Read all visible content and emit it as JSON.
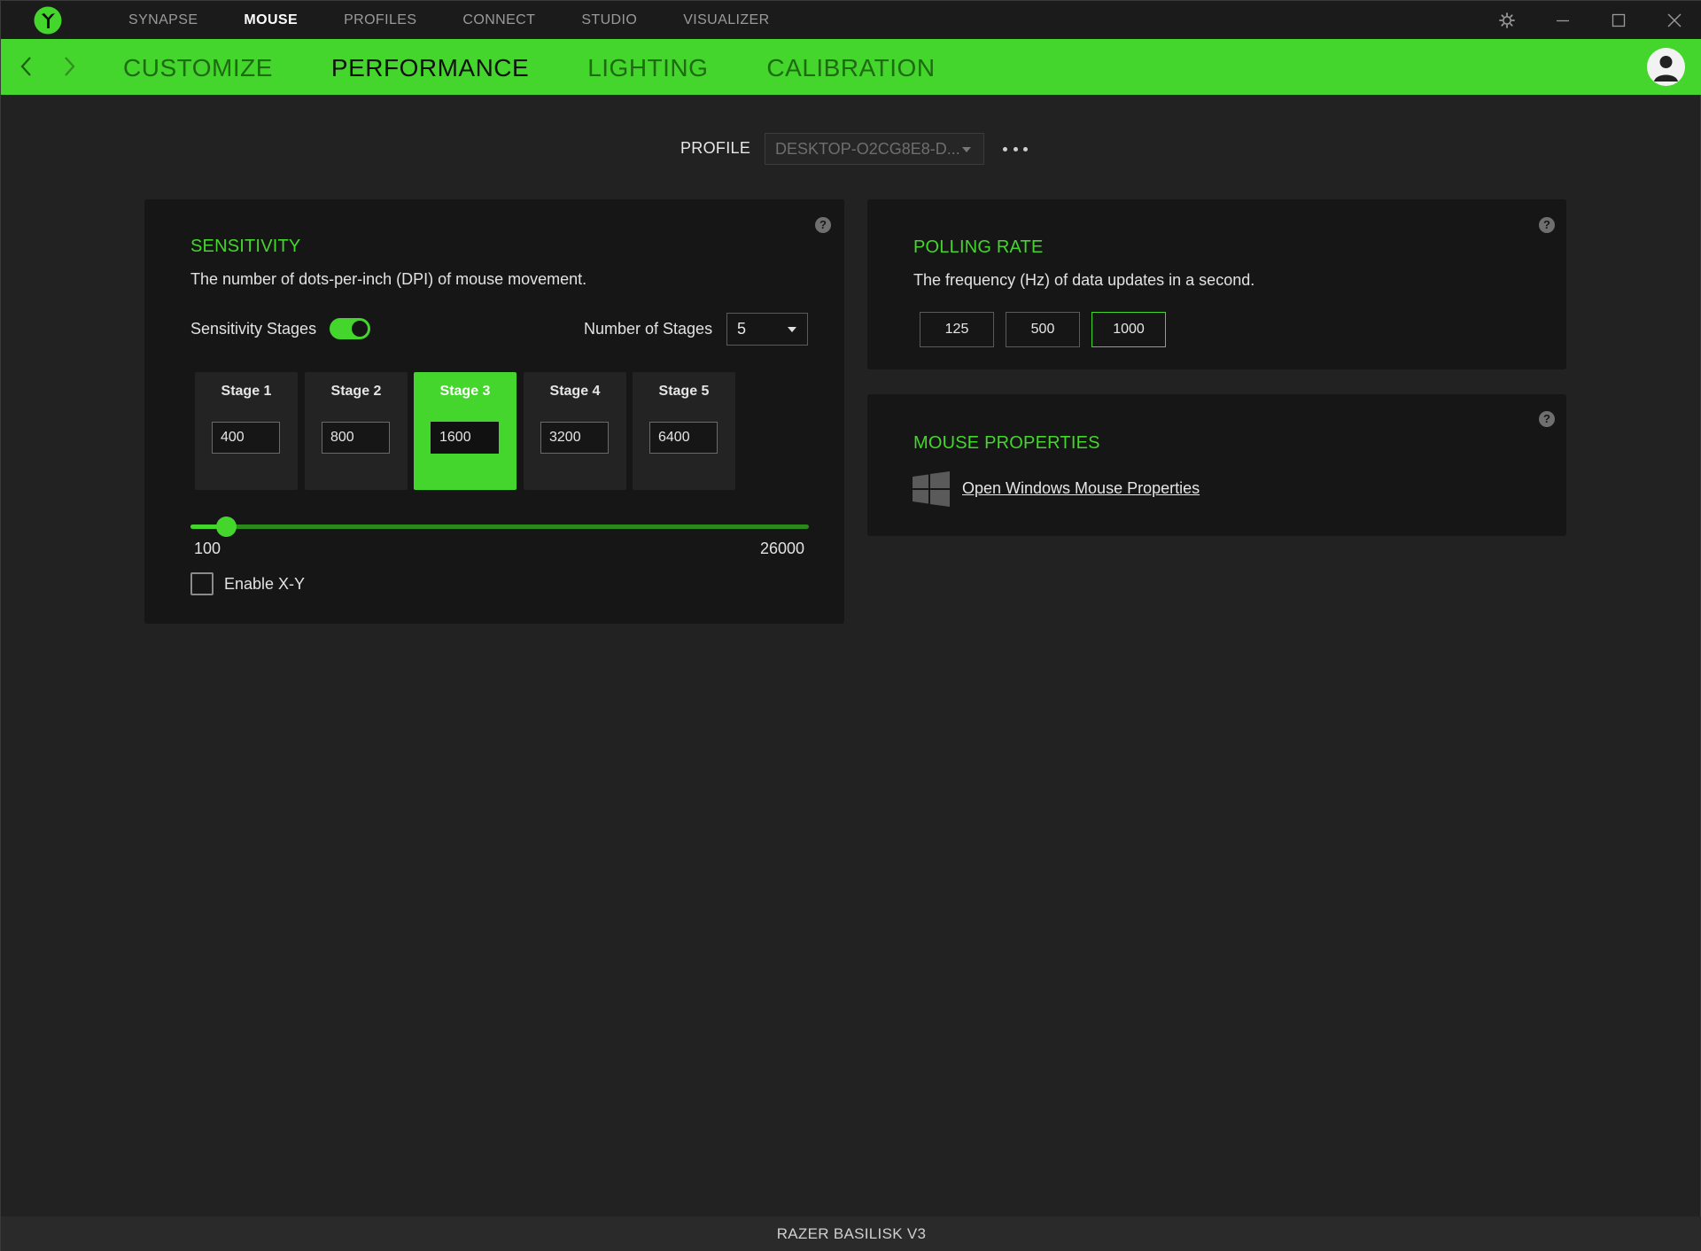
{
  "app": {
    "brand_color": "#44d62c",
    "logo_icon": "razer-snake-logo"
  },
  "top_nav": {
    "items": [
      {
        "label": "SYNAPSE"
      },
      {
        "label": "MOUSE"
      },
      {
        "label": "PROFILES"
      },
      {
        "label": "CONNECT"
      },
      {
        "label": "STUDIO"
      },
      {
        "label": "VISUALIZER"
      }
    ],
    "active": "MOUSE"
  },
  "window_controls": [
    "gear-icon",
    "minimize-icon",
    "maximize-icon",
    "close-icon"
  ],
  "sub_nav": {
    "items": [
      {
        "label": "CUSTOMIZE"
      },
      {
        "label": "PERFORMANCE"
      },
      {
        "label": "LIGHTING"
      },
      {
        "label": "CALIBRATION"
      }
    ],
    "active": "PERFORMANCE"
  },
  "profile": {
    "label": "PROFILE",
    "selected": "DESKTOP-O2CG8E8-D..."
  },
  "sensitivity": {
    "title": "SENSITIVITY",
    "description": "The number of dots-per-inch (DPI) of mouse movement.",
    "stages_label": "Sensitivity Stages",
    "stages_enabled": true,
    "num_stages_label": "Number of Stages",
    "num_stages_value": "5",
    "active_stage": 3,
    "stages": [
      {
        "name": "Stage 1",
        "value": "400"
      },
      {
        "name": "Stage 2",
        "value": "800"
      },
      {
        "name": "Stage 3",
        "value": "1600"
      },
      {
        "name": "Stage 4",
        "value": "3200"
      },
      {
        "name": "Stage 5",
        "value": "6400"
      }
    ],
    "slider": {
      "min": "100",
      "max": "26000",
      "value": 1600
    },
    "enable_xy_label": "Enable X-Y",
    "enable_xy_checked": false
  },
  "polling_rate": {
    "title": "POLLING RATE",
    "description": "The frequency (Hz) of data updates in a second.",
    "options": [
      {
        "label": "125"
      },
      {
        "label": "500"
      },
      {
        "label": "1000"
      }
    ],
    "selected": "1000"
  },
  "mouse_properties": {
    "title": "MOUSE PROPERTIES",
    "link": "Open Windows Mouse Properties"
  },
  "help_glyph": "?",
  "footer": {
    "device": "RAZER BASILISK V3"
  }
}
